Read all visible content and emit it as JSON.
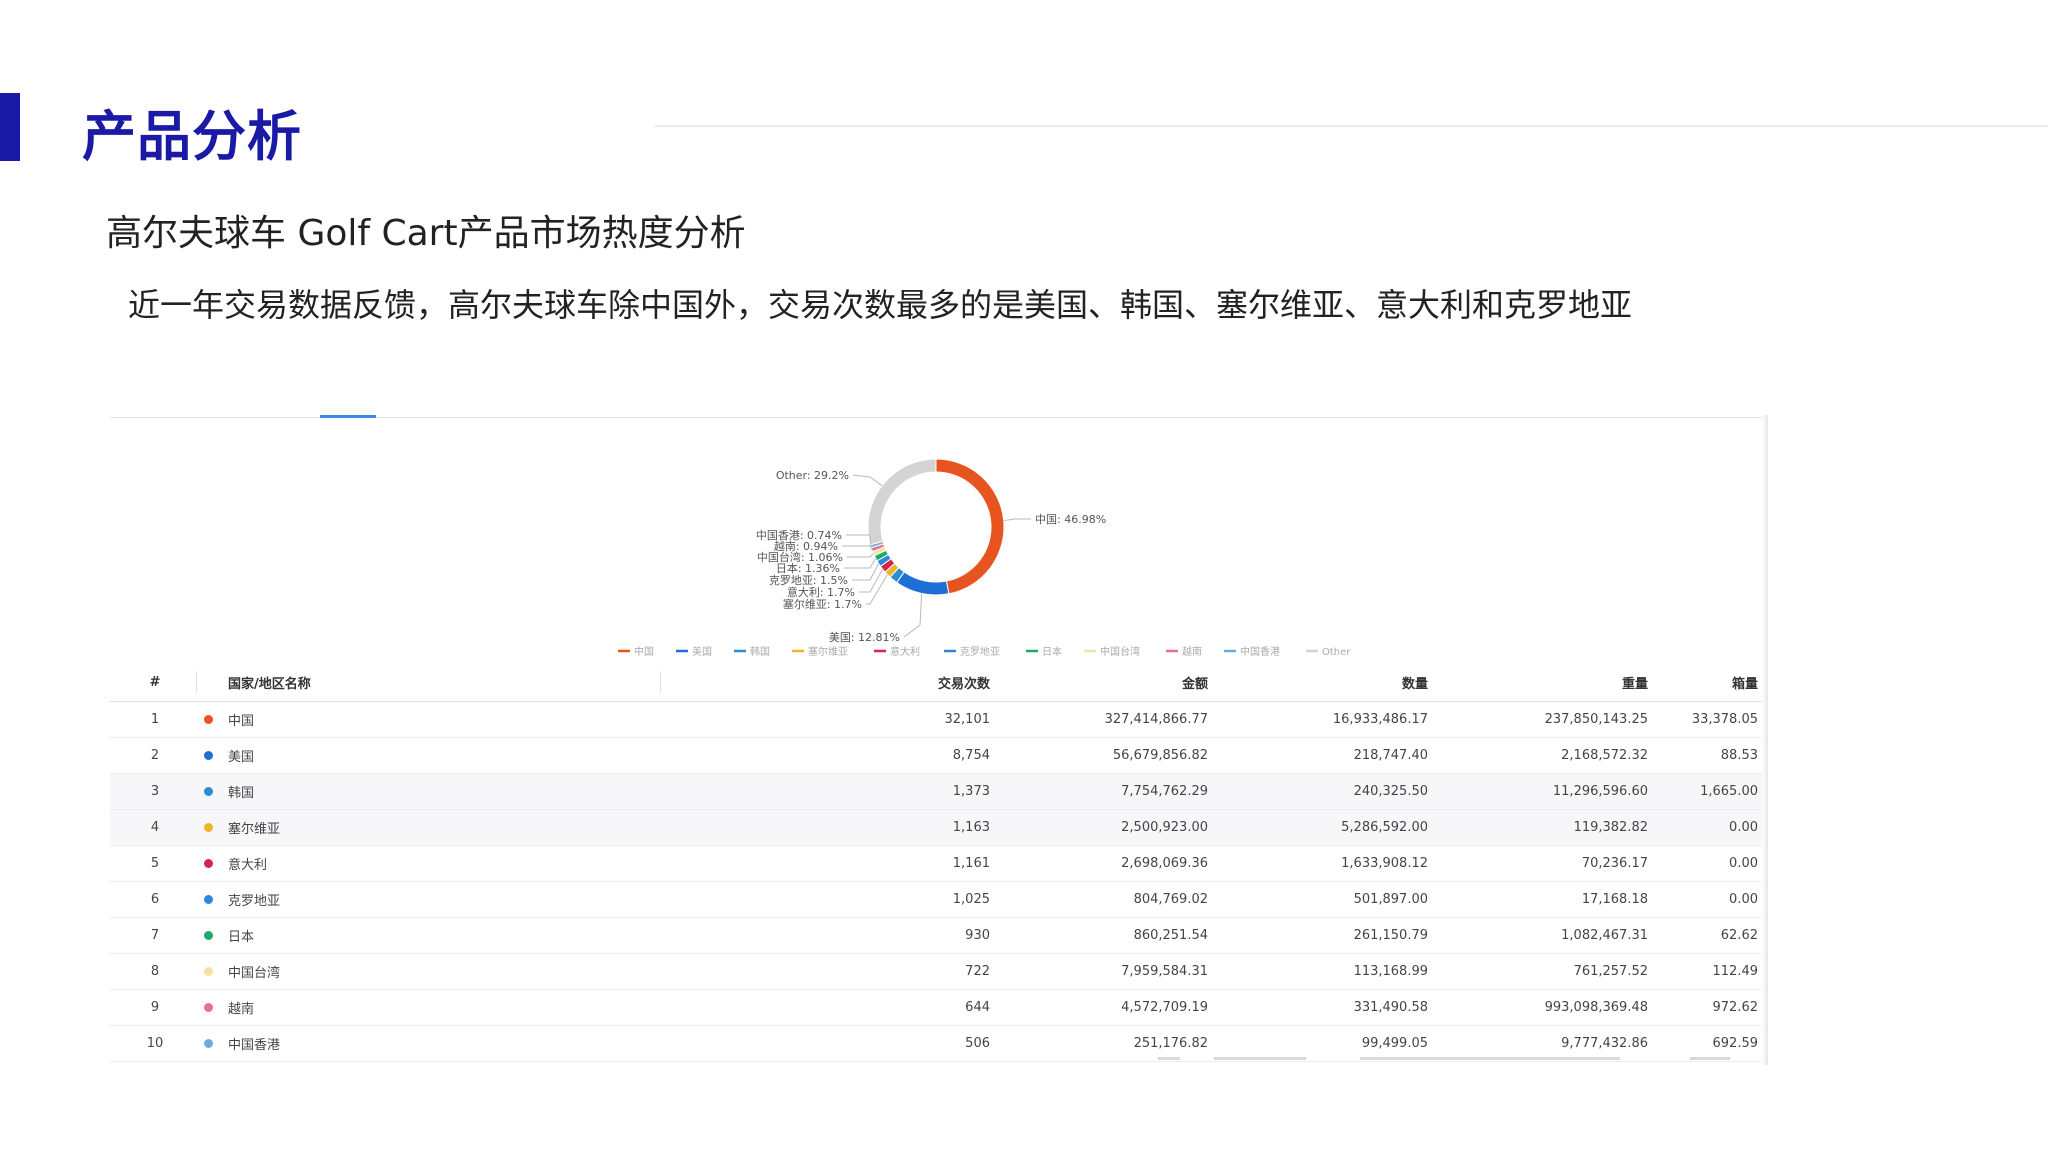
{
  "header": {
    "title": "产品分析",
    "subtitle": "高尔夫球车 Golf Cart产品市场热度分析",
    "finding": "近一年交易数据反馈，高尔夫球车除中国外，交易次数最多的是美国、韩国、塞尔维亚、意大利和克罗地亚"
  },
  "table": {
    "columns": [
      "#",
      "国家/地区名称",
      "交易次数",
      "金额",
      "数量",
      "重量",
      "箱量"
    ],
    "rows": [
      {
        "idx": "1",
        "name": "中国",
        "trx": "32,101",
        "amt": "327,414,866.77",
        "qty": "16,933,486.17",
        "wt": "237,850,143.25",
        "box": "33,378.05",
        "color": "#e8541f"
      },
      {
        "idx": "2",
        "name": "美国",
        "trx": "8,754",
        "amt": "56,679,856.82",
        "qty": "218,747.40",
        "wt": "2,168,572.32",
        "box": "88.53",
        "color": "#1d6fd6"
      },
      {
        "idx": "3",
        "name": "韩国",
        "trx": "1,373",
        "amt": "7,754,762.29",
        "qty": "240,325.50",
        "wt": "11,296,596.60",
        "box": "1,665.00",
        "color": "#2b8fcf"
      },
      {
        "idx": "4",
        "name": "塞尔维亚",
        "trx": "1,163",
        "amt": "2,500,923.00",
        "qty": "5,286,592.00",
        "wt": "119,382.82",
        "box": "0.00",
        "color": "#f0b429"
      },
      {
        "idx": "5",
        "name": "意大利",
        "trx": "1,161",
        "amt": "2,698,069.36",
        "qty": "1,633,908.12",
        "wt": "70,236.17",
        "box": "0.00",
        "color": "#d6254a"
      },
      {
        "idx": "6",
        "name": "克罗地亚",
        "trx": "1,025",
        "amt": "804,769.02",
        "qty": "501,897.00",
        "wt": "17,168.18",
        "box": "0.00",
        "color": "#2e86de"
      },
      {
        "idx": "7",
        "name": "日本",
        "trx": "930",
        "amt": "860,251.54",
        "qty": "261,150.79",
        "wt": "1,082,467.31",
        "box": "62.62",
        "color": "#1faa6a"
      },
      {
        "idx": "8",
        "name": "中国台湾",
        "trx": "722",
        "amt": "7,959,584.31",
        "qty": "113,168.99",
        "wt": "761,257.52",
        "box": "112.49",
        "color": "#f3e3a0"
      },
      {
        "idx": "9",
        "name": "越南",
        "trx": "644",
        "amt": "4,572,709.19",
        "qty": "331,490.58",
        "wt": "993,098,369.48",
        "box": "972.62",
        "color": "#e8708a"
      },
      {
        "idx": "10",
        "name": "中国香港",
        "trx": "506",
        "amt": "251,176.82",
        "qty": "99,499.05",
        "wt": "9,777,432.86",
        "box": "692.59",
        "color": "#6aaee0"
      }
    ]
  },
  "chart_data": {
    "type": "pie",
    "donut": true,
    "title": "",
    "legend_position": "bottom",
    "series": [
      {
        "name": "中国",
        "value": 46.98,
        "label": "中国: 46.98%",
        "color": "#e8541f"
      },
      {
        "name": "美国",
        "value": 12.81,
        "label": "美国: 12.81%",
        "color": "#1d6fd6"
      },
      {
        "name": "韩国",
        "value": 2.01,
        "label": "",
        "color": "#2b8fcf"
      },
      {
        "name": "塞尔维亚",
        "value": 1.7,
        "label": "塞尔维亚: 1.7%",
        "color": "#f0b429"
      },
      {
        "name": "意大利",
        "value": 1.7,
        "label": "意大利: 1.7%",
        "color": "#d6254a"
      },
      {
        "name": "克罗地亚",
        "value": 1.5,
        "label": "克罗地亚: 1.5%",
        "color": "#2e86de"
      },
      {
        "name": "日本",
        "value": 1.36,
        "label": "日本: 1.36%",
        "color": "#1faa6a"
      },
      {
        "name": "中国台湾",
        "value": 1.06,
        "label": "中国台湾: 1.06%",
        "color": "#f3e3a0"
      },
      {
        "name": "越南",
        "value": 0.94,
        "label": "越南: 0.94%",
        "color": "#e8708a"
      },
      {
        "name": "中国香港",
        "value": 0.74,
        "label": "中国香港: 0.74%",
        "color": "#6aaee0"
      },
      {
        "name": "Other",
        "value": 29.2,
        "label": "Other: 29.2%",
        "color": "#d4d4d4"
      }
    ]
  }
}
